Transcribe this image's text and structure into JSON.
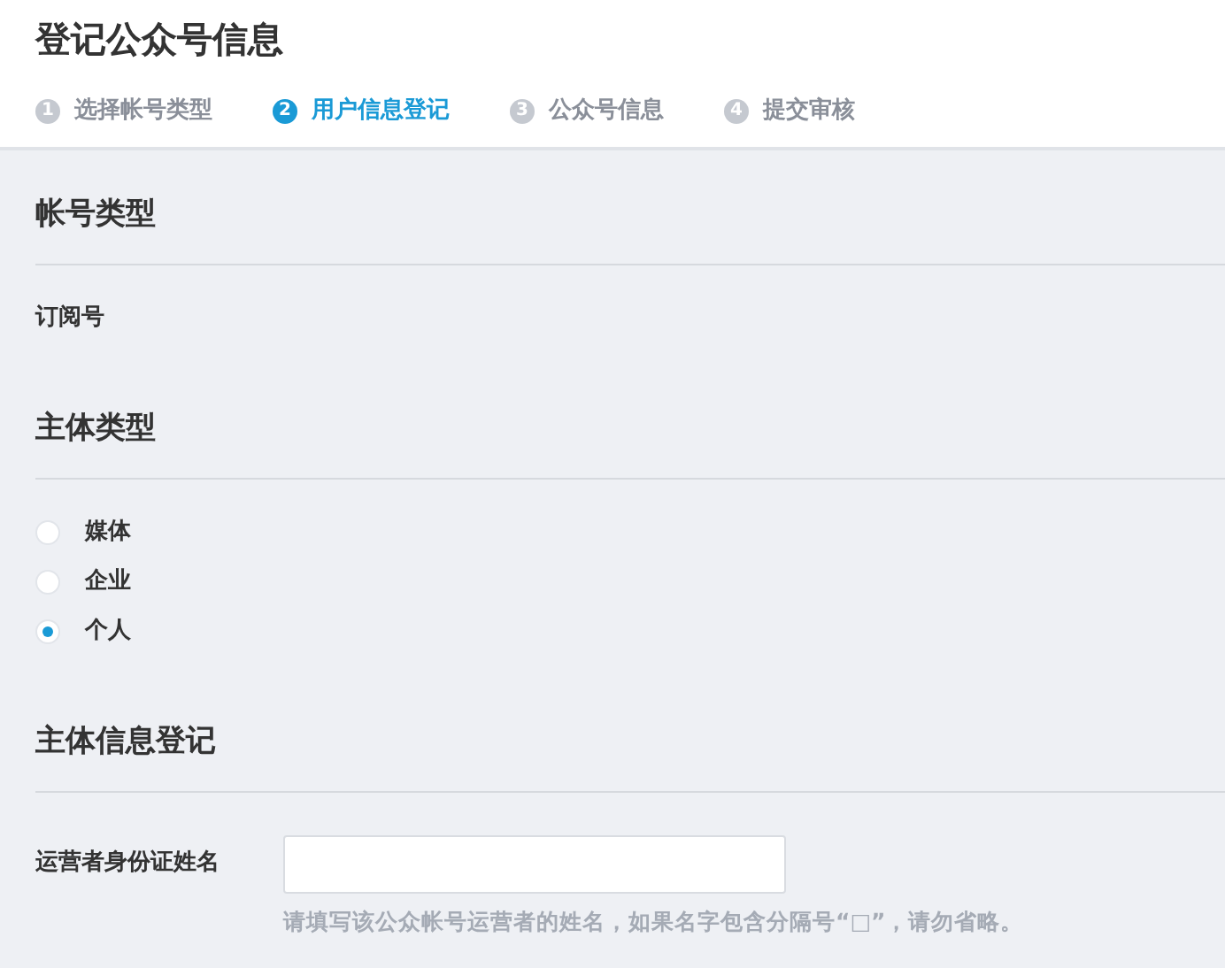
{
  "page_title": "登记公众号信息",
  "steps": [
    {
      "number": "1",
      "label": "选择帐号类型",
      "selected": false
    },
    {
      "number": "2",
      "label": "用户信息登记",
      "selected": true
    },
    {
      "number": "3",
      "label": "公众号信息",
      "selected": false
    },
    {
      "number": "4",
      "label": "提交审核",
      "selected": false
    }
  ],
  "account_type": {
    "heading": "帐号类型",
    "value": "订阅号"
  },
  "subject_type": {
    "heading": "主体类型",
    "options": [
      {
        "label": "媒体",
        "selected": false
      },
      {
        "label": "企业",
        "selected": false
      },
      {
        "label": "个人",
        "selected": true
      }
    ]
  },
  "subject_info": {
    "heading": "主体信息登记",
    "field_label": "运营者身份证姓名",
    "hint": "请填写该公众帐号运营者的姓名，如果名字包含分隔号“□”，请勿省略。"
  }
}
